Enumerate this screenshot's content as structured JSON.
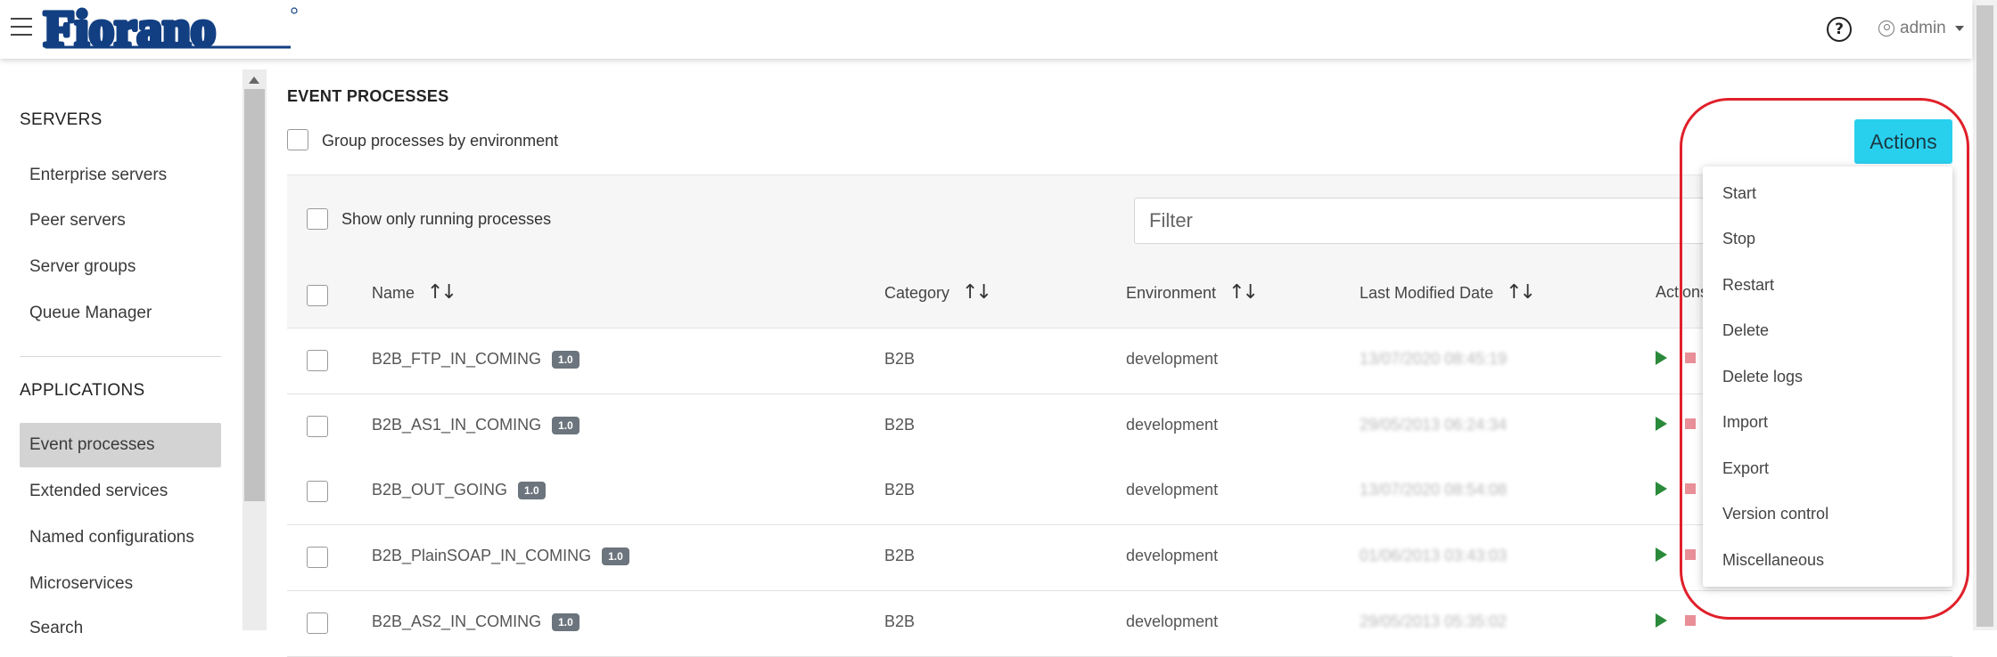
{
  "header": {
    "logo_text": "Fiorano",
    "user": "admin"
  },
  "sidebar": {
    "servers_title": "SERVERS",
    "server_items": [
      "Enterprise servers",
      "Peer servers",
      "Server groups",
      "Queue Manager"
    ],
    "applications_title": "APPLICATIONS",
    "application_items": [
      "Event processes",
      "Extended services",
      "Named configurations",
      "Microservices",
      "Search"
    ],
    "active_item": "Event processes"
  },
  "main": {
    "title": "EVENT PROCESSES",
    "group_label": "Group processes by environment",
    "running_label": "Show only running processes",
    "filter_placeholder": "Filter",
    "actions_label": "Actions",
    "columns": [
      "Name",
      "Category",
      "Environment",
      "Last Modified Date",
      "Actions"
    ],
    "rows": [
      {
        "name": "B2B_FTP_IN_COMING",
        "version": "1.0",
        "category": "B2B",
        "environment": "development",
        "modified": "13/07/2020 08:45:19"
      },
      {
        "name": "B2B_AS1_IN_COMING",
        "version": "1.0",
        "category": "B2B",
        "environment": "development",
        "modified": "29/05/2013 06:24:34"
      },
      {
        "name": "B2B_OUT_GOING",
        "version": "1.0",
        "category": "B2B",
        "environment": "development",
        "modified": "13/07/2020 08:54:08"
      },
      {
        "name": "B2B_PlainSOAP_IN_COMING",
        "version": "1.0",
        "category": "B2B",
        "environment": "development",
        "modified": "01/06/2013 03:43:03"
      },
      {
        "name": "B2B_AS2_IN_COMING",
        "version": "1.0",
        "category": "B2B",
        "environment": "development",
        "modified": "29/05/2013 05:35:02"
      }
    ]
  },
  "actions_menu": {
    "items": [
      "Start",
      "Stop",
      "Restart",
      "Delete",
      "Delete logs",
      "Import",
      "Export",
      "Version control",
      "Miscellaneous"
    ]
  },
  "colors": {
    "actions_button": "#29d0ee",
    "highlight": "#e0202a",
    "start_icon": "#2a8a3a",
    "stop_icon": "#e88f98",
    "version_badge": "#6c757d"
  }
}
